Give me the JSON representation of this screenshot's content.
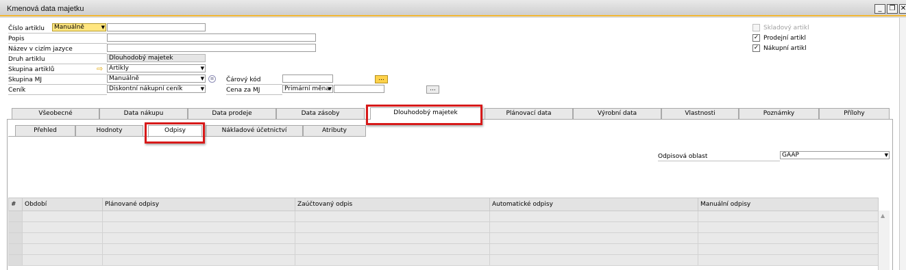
{
  "window": {
    "title": "Kmenová data majetku",
    "minimize": "_",
    "restore": "❐",
    "close": "✕"
  },
  "form": {
    "item_number_label": "Číslo artiklu",
    "item_number_series": "Manuálně",
    "item_number_value": "",
    "description_label": "Popis",
    "description_value": "",
    "foreign_name_label": "Název v cizím jazyce",
    "foreign_name_value": "",
    "item_type_label": "Druh artiklu",
    "item_type_value": "Dlouhodobý majetek",
    "item_group_label": "Skupina artiklů",
    "item_group_value": "Artikly",
    "uom_group_label": "Skupina MJ",
    "uom_group_value": "Manuálně",
    "price_list_label": "Ceník",
    "price_list_value": "Diskontní nákupní ceník",
    "barcode_label": "Čárový kód",
    "barcode_value": "",
    "barcode_button": "...",
    "unit_price_label": "Cena za MJ",
    "unit_price_currency": "Primární měna",
    "unit_price_value": "",
    "unit_price_button": "..."
  },
  "checkboxes": [
    {
      "label": "Skladový artikl",
      "checked": false,
      "disabled": true
    },
    {
      "label": "Prodejní artikl",
      "checked": true,
      "disabled": false
    },
    {
      "label": "Nákupní artikl",
      "checked": true,
      "disabled": false
    }
  ],
  "tabs": [
    {
      "label": "Všeobecné"
    },
    {
      "label": "Data nákupu"
    },
    {
      "label": "Data prodeje"
    },
    {
      "label": "Data zásoby"
    },
    {
      "label": "Dlouhodobý majetek",
      "active": true
    },
    {
      "label": "Plánovací data"
    },
    {
      "label": "Výrobní data"
    },
    {
      "label": "Vlastnosti"
    },
    {
      "label": "Poznámky"
    },
    {
      "label": "Přílohy"
    }
  ],
  "subtabs": [
    {
      "label": "Přehled"
    },
    {
      "label": "Hodnoty"
    },
    {
      "label": "Odpisy",
      "active": true
    },
    {
      "label": "Nákladové účetnictví"
    },
    {
      "label": "Atributy"
    }
  ],
  "depreciation_area": {
    "label": "Odpisová oblast",
    "value": "GAAP"
  },
  "grid": {
    "columns": [
      "#",
      "Období",
      "Plánované odpisy",
      "Zaúčtovaný odpis",
      "Automatické odpisy",
      "Manuální odpisy"
    ],
    "rows": [
      [
        "",
        "",
        "",
        "",
        "",
        ""
      ],
      [
        "",
        "",
        "",
        "",
        "",
        ""
      ],
      [
        "",
        "",
        "",
        "",
        "",
        ""
      ],
      [
        "",
        "",
        "",
        "",
        "",
        ""
      ],
      [
        "",
        "",
        "",
        "",
        "",
        ""
      ]
    ]
  },
  "colors": {
    "accent": "#f2b733",
    "highlight": "#d71919"
  },
  "icons": {
    "group_arrow": "arrow-right-icon",
    "uom_info": "info-circle-icon",
    "scroll_up": "scroll-up-icon"
  }
}
